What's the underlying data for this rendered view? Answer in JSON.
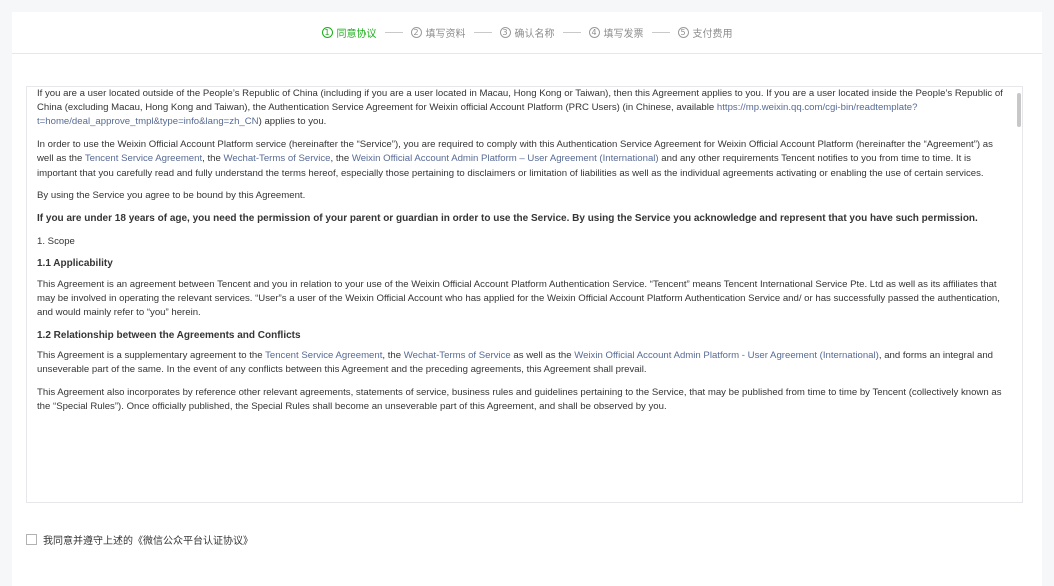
{
  "steps": [
    {
      "num": "1",
      "label": "同意协议",
      "active": true
    },
    {
      "num": "2",
      "label": "填写资料",
      "active": false
    },
    {
      "num": "3",
      "label": "确认名称",
      "active": false
    },
    {
      "num": "4",
      "label": "填写发票",
      "active": false
    },
    {
      "num": "5",
      "label": "支付费用",
      "active": false
    }
  ],
  "agreement": {
    "p1_a": "If you are a user located outside of the People’s Republic of China (including if you are a user located in Macau, Hong Kong or Taiwan), then this Agreement applies to you. If you are a user located inside the People’s Republic of China (excluding Macau, Hong Kong and Taiwan), the Authentication Service Agreement for Weixin official Account Platform (PRC Users) (in Chinese, available ",
    "p1_link": "https://mp.weixin.qq.com/cgi-bin/readtemplate?t=home/deal_approve_tmpl&type=info&lang=zh_CN",
    "p1_b": ") applies to you.",
    "p2_a": "In order to use the Weixin Official Account Platform service (hereinafter the “Service”), you are required to comply with this Authentication Service Agreement for Weixin Official Account Platform (hereinafter the “Agreement”) as well as the ",
    "p2_link1": "Tencent Service Agreement",
    "p2_b": ", the ",
    "p2_link2": "Wechat-Terms of Service",
    "p2_c": ", the ",
    "p2_link3": "Weixin Official Account Admin Platform – User Agreement (International)",
    "p2_d": " and any other requirements Tencent notifies to you from time to time. It is important that you carefully read and fully understand the terms hereof, especially those pertaining to disclaimers or limitation of liabilities as well as the individual agreements activating or enabling the use of certain services.",
    "p3": "By using the Service you agree to be bound by this Agreement.",
    "p4": "If you are under 18 years of age, you need the permission of your parent or guardian in order to use the Service. By using the Service you acknowledge and represent that you have such permission.",
    "scope": "1. Scope",
    "h11": "1.1 Applicability",
    "p11": "This Agreement is an agreement between Tencent and you in relation to your use of the Weixin Official Account Platform Authentication Service. “Tencent” means Tencent International Service Pte. Ltd as well as its affiliates that may be involved in operating the relevant services. “User”s a user of the Weixin Official Account who has applied for the Weixin Official Account Platform Authentication Service and/ or has successfully passed the authentication, and would mainly refer to “you” herein.",
    "h12": "1.2 Relationship between the Agreements and Conflicts",
    "p12_a": "This Agreement is a supplementary agreement to the ",
    "p12_link1": "Tencent Service Agreement",
    "p12_b": ", the ",
    "p12_link2": "Wechat-Terms of Service",
    "p12_c": " as well as the ",
    "p12_link3": "Weixin Official Account Admin Platform - User Agreement (International)",
    "p12_d": ", and forms an integral and unseverable part of the same. In the event of any conflicts between this Agreement and the preceding agreements, this Agreement shall prevail.",
    "p13": "This Agreement also incorporates by reference other relevant agreements, statements of service, business rules and guidelines pertaining to the Service, that may be published from time to time by Tencent (collectively known as the “Special Rules”). Once officially published, the Special Rules shall become an unseverable part of this Agreement, and shall be observed by you."
  },
  "agree_checkbox_label": "我同意并遵守上述的《微信公众平台认证协议》",
  "colors": {
    "accent": "#1aad19",
    "link": "#576b95"
  }
}
